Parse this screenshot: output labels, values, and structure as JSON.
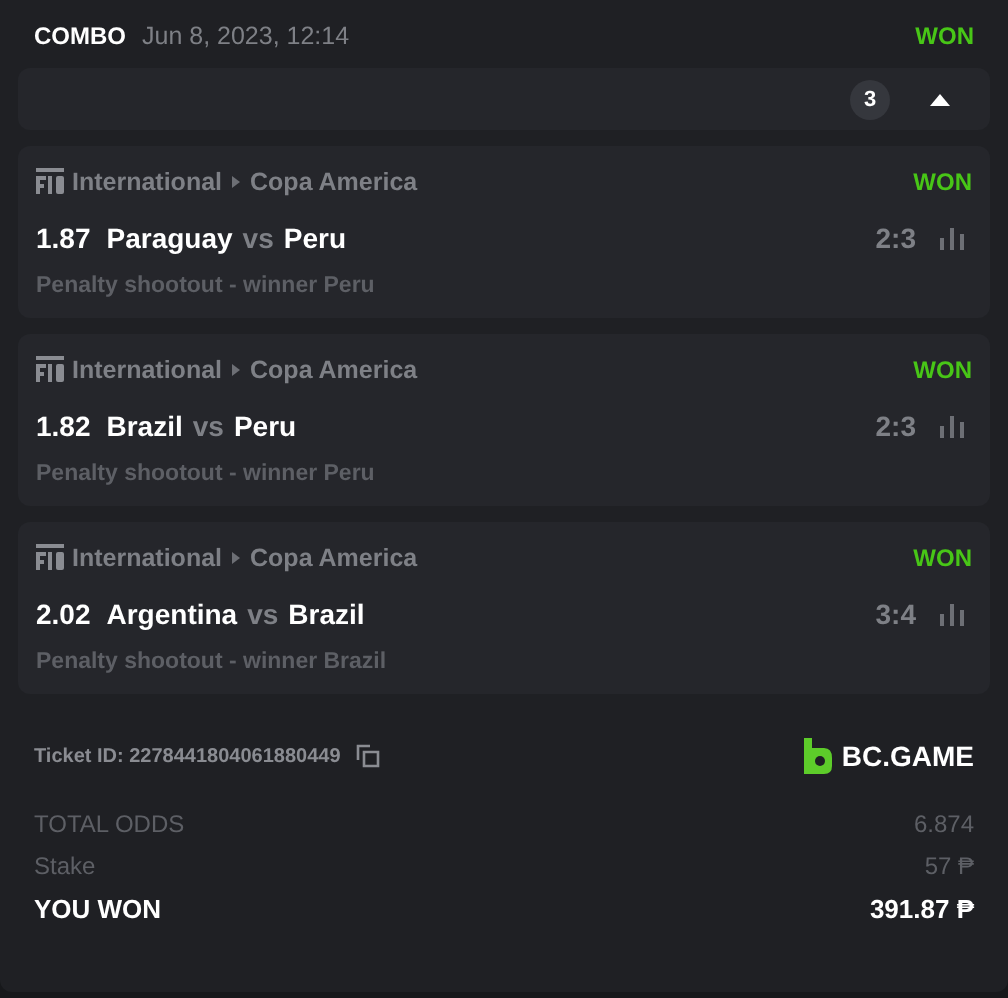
{
  "header": {
    "type": "COMBO",
    "date": "Jun 8, 2023, 12:14",
    "status": "WON"
  },
  "summary_bar": {
    "count": "3",
    "expanded": true
  },
  "bets": [
    {
      "category": "International",
      "league": "Copa America",
      "status": "WON",
      "odds": "1.87",
      "home": "Paraguay",
      "vs": "vs",
      "away": "Peru",
      "score": "2:3",
      "market": "Penalty shootout - winner Peru"
    },
    {
      "category": "International",
      "league": "Copa America",
      "status": "WON",
      "odds": "1.82",
      "home": "Brazil",
      "vs": "vs",
      "away": "Peru",
      "score": "2:3",
      "market": "Penalty shootout - winner Peru"
    },
    {
      "category": "International",
      "league": "Copa America",
      "status": "WON",
      "odds": "2.02",
      "home": "Argentina",
      "vs": "vs",
      "away": "Brazil",
      "score": "3:4",
      "market": "Penalty shootout - winner Brazil"
    }
  ],
  "ticket": {
    "id": "Ticket ID: 2278441804061880449",
    "brand": "BC.GAME"
  },
  "totals": [
    {
      "kind": "plain",
      "label": "TOTAL ODDS",
      "value": "6.874"
    },
    {
      "kind": "plain",
      "label": "Stake",
      "value": "57 ₱"
    },
    {
      "kind": "result",
      "label": "YOU WON",
      "value": "391.87 ₱"
    }
  ]
}
